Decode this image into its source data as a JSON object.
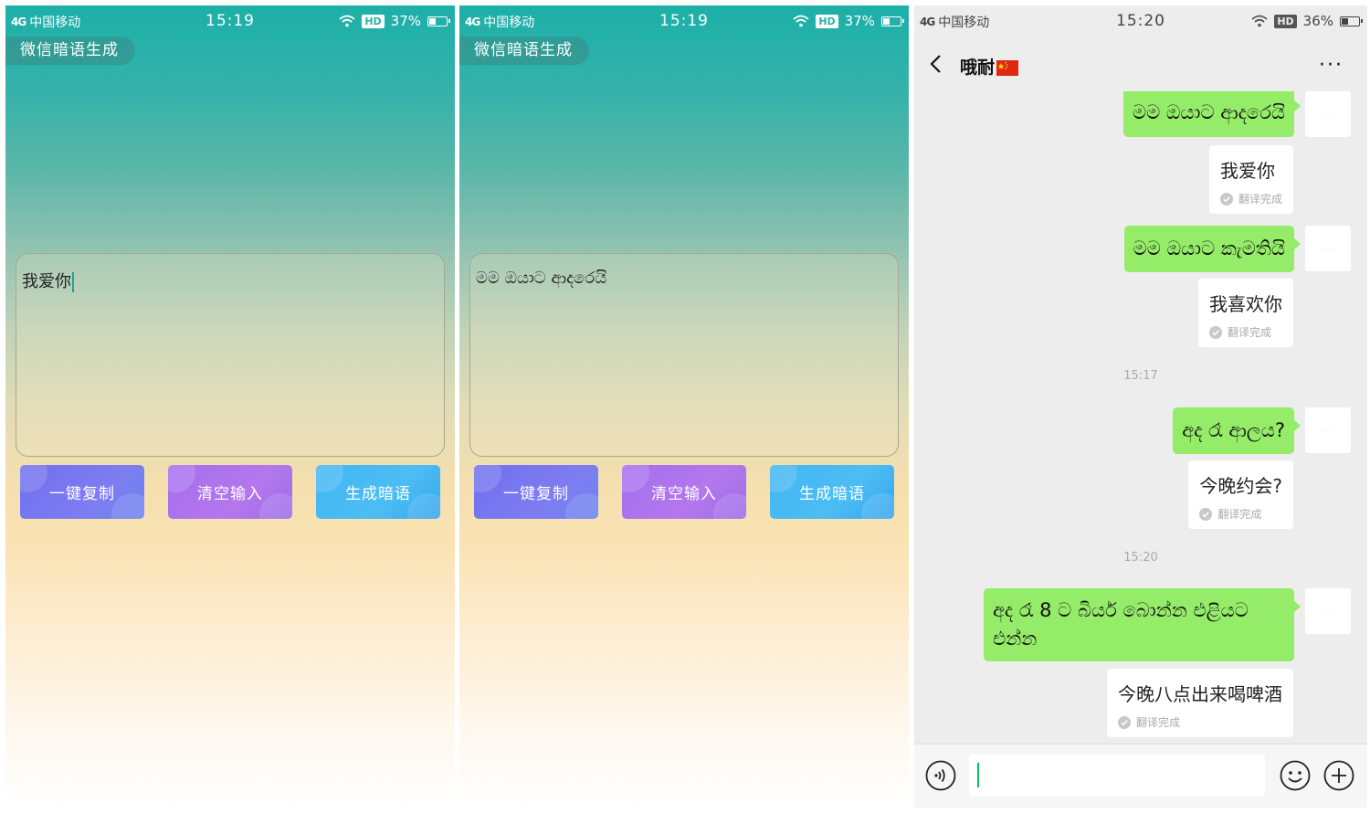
{
  "panels": [
    {
      "status": {
        "signal": "4G",
        "carrier": "中国移动",
        "time": "15:19",
        "hd": "HD",
        "battery": "37%"
      },
      "app_title": "微信暗语生成",
      "input_text": "我爱你",
      "buttons": {
        "copy": "一键复制",
        "clear": "清空输入",
        "generate": "生成暗语"
      }
    },
    {
      "status": {
        "signal": "4G",
        "carrier": "中国移动",
        "time": "15:19",
        "hd": "HD",
        "battery": "37%"
      },
      "app_title": "微信暗语生成",
      "input_text": "මම ඔයාට ආදරෙයි",
      "buttons": {
        "copy": "一键复制",
        "clear": "清空输入",
        "generate": "生成暗语"
      }
    }
  ],
  "chat": {
    "status": {
      "signal": "4G",
      "carrier": "中国移动",
      "time": "15:20",
      "hd": "HD",
      "battery": "36%"
    },
    "header": {
      "title": "哦耐",
      "flag": "china-flag-icon"
    },
    "messages": [
      {
        "text": "මම ඔයාට ආදරෙයි",
        "translation": "我爱你",
        "status": "翻译完成"
      },
      {
        "text": "මම ඔයාට කැමතියි",
        "translation": "我喜欢你",
        "status": "翻译完成"
      },
      {
        "text": "අද රෑ ආලය?",
        "translation": "今晚约会?",
        "status": "翻译完成"
      },
      {
        "text_line1": "අද රෑ 8 ට බියර් බොන්න එළියට",
        "text_line2": "එන්න",
        "translation": "今晚八点出来喝啤酒",
        "status": "翻译完成"
      }
    ],
    "times": [
      "15:17",
      "15:20"
    ]
  },
  "colors": {
    "teal_top": "#1cb0a8",
    "peach_mid": "#f5dfae",
    "wechat_green": "#95ec69",
    "btn_copy": "#7f7cf1",
    "btn_clear": "#b477ec",
    "btn_generate": "#4cbdf4",
    "chat_bg": "#ededed"
  }
}
